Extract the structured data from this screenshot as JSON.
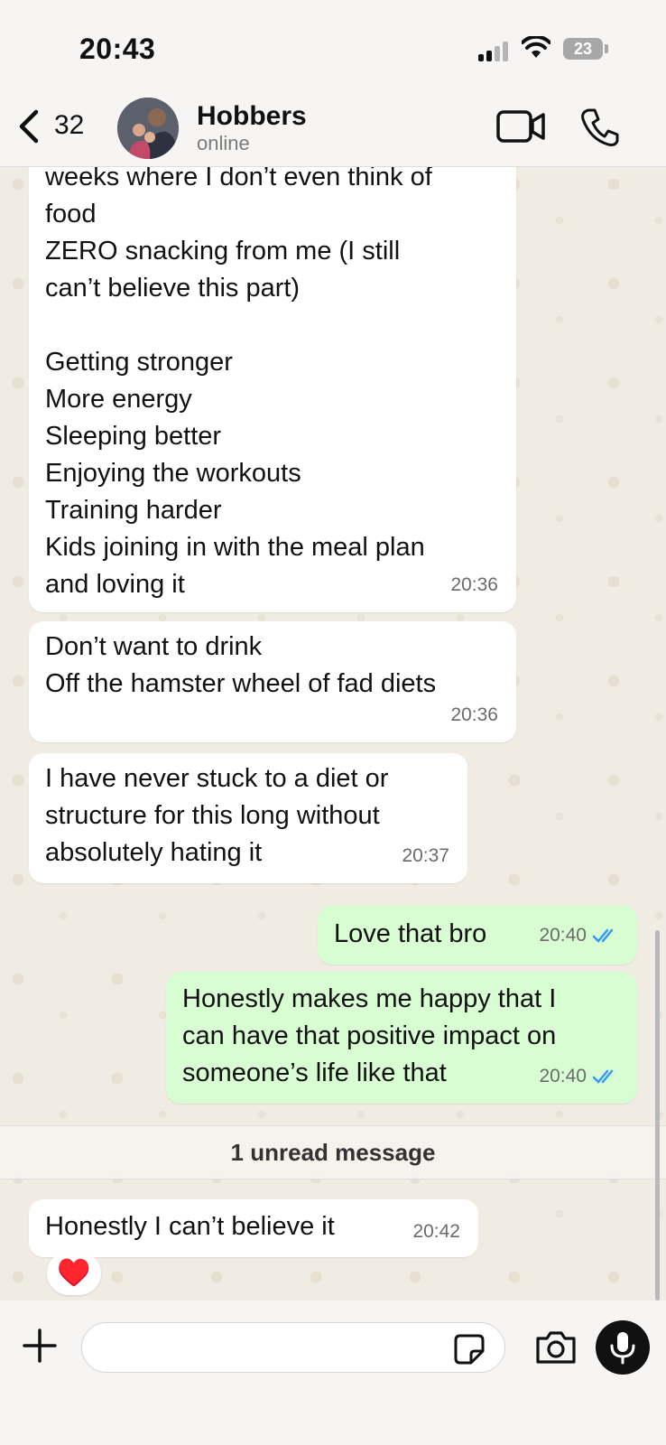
{
  "status_bar": {
    "time": "20:43",
    "battery": "23"
  },
  "header": {
    "back_count": "32",
    "contact_name": "Hobbers",
    "contact_status": "online"
  },
  "messages": [
    {
      "direction": "in",
      "text": "weeks where I don’t even think of\nfood\nZERO snacking from me (I still\ncan’t believe this part)\n\nGetting stronger\nMore energy\nSleeping better\nEnjoying the workouts\nTraining harder\nKids joining in with the meal plan\nand loving it",
      "time": "20:36"
    },
    {
      "direction": "in",
      "text": "Don’t want to drink\nOff the hamster wheel of fad diets",
      "time": "20:36"
    },
    {
      "direction": "in",
      "text": "I have never stuck to a diet or\nstructure for this long without\nabsolutely hating it",
      "time": "20:37"
    },
    {
      "direction": "out",
      "text": "Love that bro",
      "time": "20:40",
      "status": "read"
    },
    {
      "direction": "out",
      "text": "Honestly makes me happy that I\ncan have that positive impact on\nsomeone’s life like that",
      "time": "20:40",
      "status": "read"
    },
    {
      "direction": "in",
      "text": "Honestly I can’t believe it",
      "time": "20:42",
      "reaction": "♥️"
    }
  ],
  "unread_divider": "1 unread message",
  "colors": {
    "outgoing_bubble": "#d9fdd3",
    "incoming_bubble": "#ffffff",
    "read_ticks": "#3497f9"
  }
}
